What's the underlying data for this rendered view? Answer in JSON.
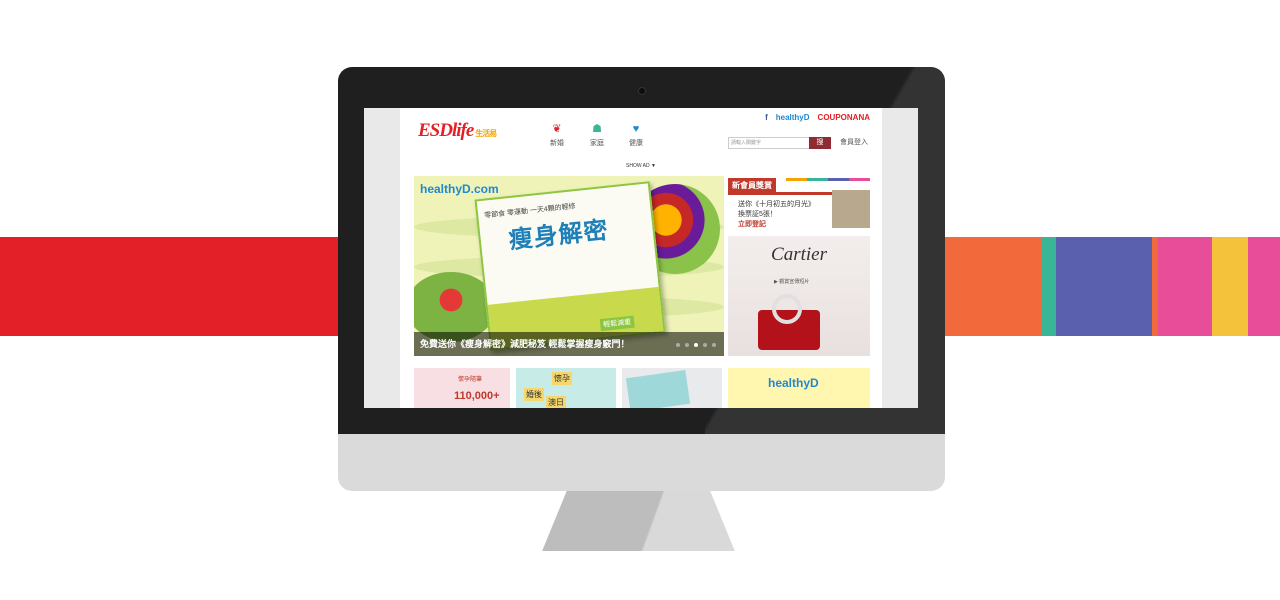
{
  "colors": {
    "band_left": "#e32027",
    "band_right": [
      "#f26a3c",
      "#3bb597",
      "#5a5fae",
      "#f26a3c",
      "#e84d9a",
      "#f5c33b",
      "#e84d9a"
    ],
    "brand_red": "#e32027",
    "healthy_blue": "#1e88d2"
  },
  "site": {
    "logo": "ESDlife",
    "logo_sub": "生活易",
    "nav": [
      {
        "label": "新婚",
        "icon": "heart-rings-icon"
      },
      {
        "label": "家庭",
        "icon": "family-icon"
      },
      {
        "label": "健康",
        "icon": "health-heart-icon"
      }
    ],
    "top_links": [
      "f",
      "healthyD",
      "COUPONANA"
    ],
    "search": {
      "placeholder": "請輸入關鍵字",
      "button": "搜"
    },
    "login": "會員登入",
    "show_ad": "SHOW AD ▼",
    "hero": {
      "logo": "healthyD.com",
      "book_top": "零節食 零運動 一天4顆的輕修",
      "book_title": "瘦身解密",
      "book_cta": "輕鬆減重",
      "caption": "免費送你《瘦身解密》減肥秘笈 輕鬆掌握瘦身竅門！"
    },
    "sidebar": {
      "member_title": "新會員獎賞",
      "promo_line1": "送你《十月初五的月光》",
      "promo_line2": "換票証5張！",
      "promo_cta": "立即登記",
      "cartier_logo": "Cartier",
      "cartier_sub": "▶ 觀賞宣傳短片"
    },
    "tiles": {
      "t1_small": "懷孕隨筆",
      "t1_big": "110,000+",
      "t2_a": "懷孕",
      "t2_b": "婚後",
      "t2_c": "澳日",
      "t4_logo": "healthyD"
    }
  }
}
